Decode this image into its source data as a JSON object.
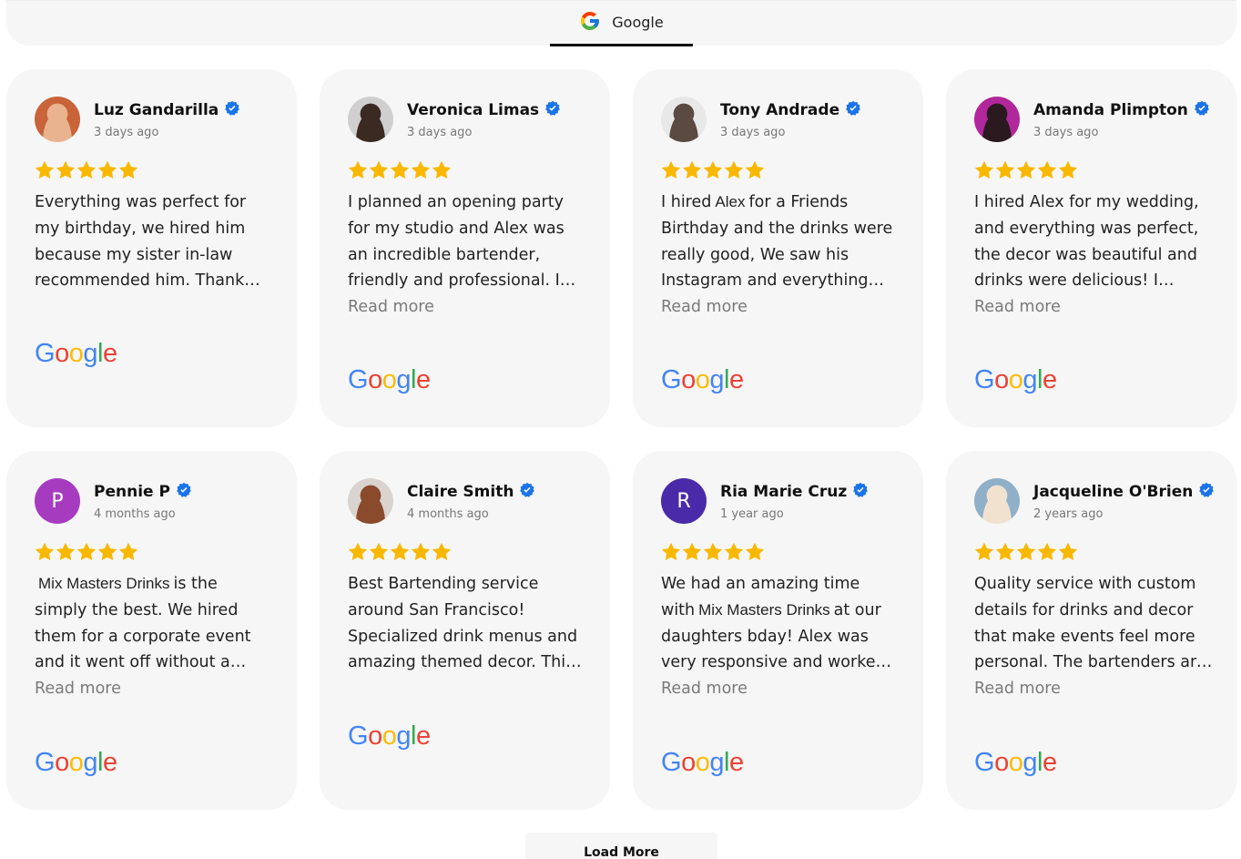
{
  "tabs": [
    {
      "label": "Google",
      "icon": "google-g-icon",
      "active": true
    }
  ],
  "reviews": [
    {
      "name": "Luz Gandarilla",
      "date": "3 days ago",
      "rating": 5,
      "text": "Everything was perfect for my birthday, we hired him because my sister in-law recommended him. Thank You !!",
      "read_more": "",
      "avatar": {
        "type": "photo",
        "colors": [
          "#c8633a",
          "#e9b38f"
        ]
      },
      "source": "Google"
    },
    {
      "name": "Veronica Limas",
      "date": "3 days ago",
      "rating": 5,
      "text": "I planned an opening party for my studio and Alex was an incredible bartender, friendly and professional. I was happy that the bar fit my aesthetic",
      "read_more": "Read more",
      "avatar": {
        "type": "photo",
        "colors": [
          "#cfcfcf",
          "#3b2a22"
        ]
      },
      "source": "Google"
    },
    {
      "name": "Tony Andrade",
      "date": "3 days ago",
      "rating": 5,
      "text_pre": "I hired",
      "brand": "Alex",
      "text_post": "for a Friends Birthday and the drinks were really good, We saw his Instagram and everything matched, he was very professional",
      "read_more": "Read more",
      "avatar": {
        "type": "photo",
        "colors": [
          "#e8e8e8",
          "#5a4a3f"
        ]
      },
      "source": "Google"
    },
    {
      "name": "Amanda Plimpton",
      "date": "3 days ago",
      "rating": 5,
      "text": "I hired Alex for my wedding, and everything was perfect, the decor was beautiful and drinks were delicious! I specifically hired Alex because",
      "read_more": "Read more",
      "avatar": {
        "type": "photo",
        "colors": [
          "#b0289b",
          "#2a1a20"
        ]
      },
      "source": "Google"
    },
    {
      "name": "Pennie P",
      "date": "4 months ago",
      "rating": 5,
      "text_pre": "",
      "brand": "Mix Masters Drinks",
      "text_post": "is the simply the best. We hired them for a corporate event and it went off without a hitch. Speciality menus, great bartenders",
      "read_more": "Read more",
      "avatar": {
        "type": "initial",
        "initial": "P",
        "colors": [
          "#a63bc0"
        ]
      },
      "source": "Google"
    },
    {
      "name": "Claire Smith",
      "date": "4 months ago",
      "rating": 5,
      "text": "Best Bartending service around San Francisco! Specialized drink menus and amazing themed decor. This is a brilliant company!",
      "read_more": "",
      "avatar": {
        "type": "photo",
        "colors": [
          "#d9d4cf",
          "#8a4a2c"
        ]
      },
      "source": "Google"
    },
    {
      "name": "Ria Marie Cruz",
      "date": "1 year ago",
      "rating": 5,
      "text_pre": "We had an amazing time with",
      "brand": "Mix Masters Drinks",
      "text_post": "at our daughters bday! Alex was very responsive and worked with us in such a short time",
      "read_more": "Read more",
      "avatar": {
        "type": "initial",
        "initial": "R",
        "colors": [
          "#4a2aa8"
        ]
      },
      "source": "Google"
    },
    {
      "name": "Jacqueline O'Brien",
      "date": "2 years ago",
      "rating": 5,
      "text": "Quality service with custom details for drinks and decor that make events feel more personal. The bartenders are friendly and help facilitate a great time",
      "read_more": "Read more",
      "avatar": {
        "type": "photo",
        "colors": [
          "#8fb0c8",
          "#f1e2d0"
        ]
      },
      "source": "Google"
    }
  ],
  "load_more_label": "Load More",
  "colors": {
    "card_bg": "#f6f6f6",
    "star": "#F9B800",
    "verified": "#1a73e8",
    "read_more": "#7a7a7a"
  }
}
